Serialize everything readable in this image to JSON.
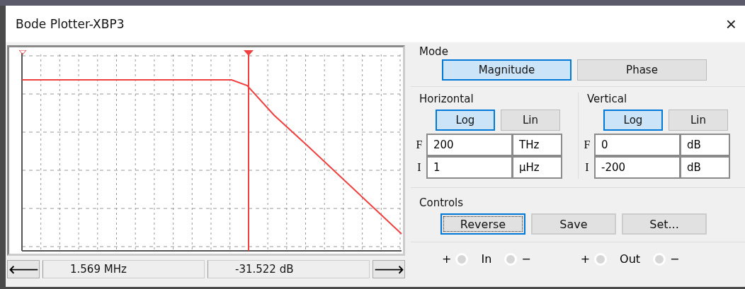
{
  "window": {
    "title": "Bode Plotter-XBP3",
    "close": "×"
  },
  "readout": {
    "left_arrow": "🡐",
    "frequency": "1.569 MHz",
    "gain": "-31.522 dB",
    "right_arrow": "🡒"
  },
  "mode": {
    "label": "Mode",
    "options": [
      {
        "label": "Magnitude",
        "selected": true
      },
      {
        "label": "Phase",
        "selected": false
      }
    ]
  },
  "axes": [
    {
      "label": "Horizontal",
      "scales": [
        {
          "label": "Log",
          "selected": true
        },
        {
          "label": "Lin",
          "selected": false
        }
      ],
      "fields": [
        {
          "prefix": "F",
          "value": "200",
          "unit": "THz"
        },
        {
          "prefix": "I",
          "value": "1",
          "unit": "µHz"
        }
      ]
    },
    {
      "label": "Vertical",
      "scales": [
        {
          "label": "Log",
          "selected": true
        },
        {
          "label": "Lin",
          "selected": false
        }
      ],
      "fields": [
        {
          "prefix": "F",
          "value": "0",
          "unit": "dB"
        },
        {
          "prefix": "I",
          "value": "-200",
          "unit": "dB"
        }
      ]
    }
  ],
  "controls": {
    "label": "Controls",
    "buttons": [
      {
        "label": "Reverse",
        "focused": true
      },
      {
        "label": "Save",
        "focused": false
      },
      {
        "label": "Set...",
        "focused": false
      }
    ]
  },
  "terminals": [
    {
      "plus": "+",
      "label": "In",
      "minus": "−"
    },
    {
      "plus": "+",
      "label": "Out",
      "minus": "−"
    }
  ]
}
